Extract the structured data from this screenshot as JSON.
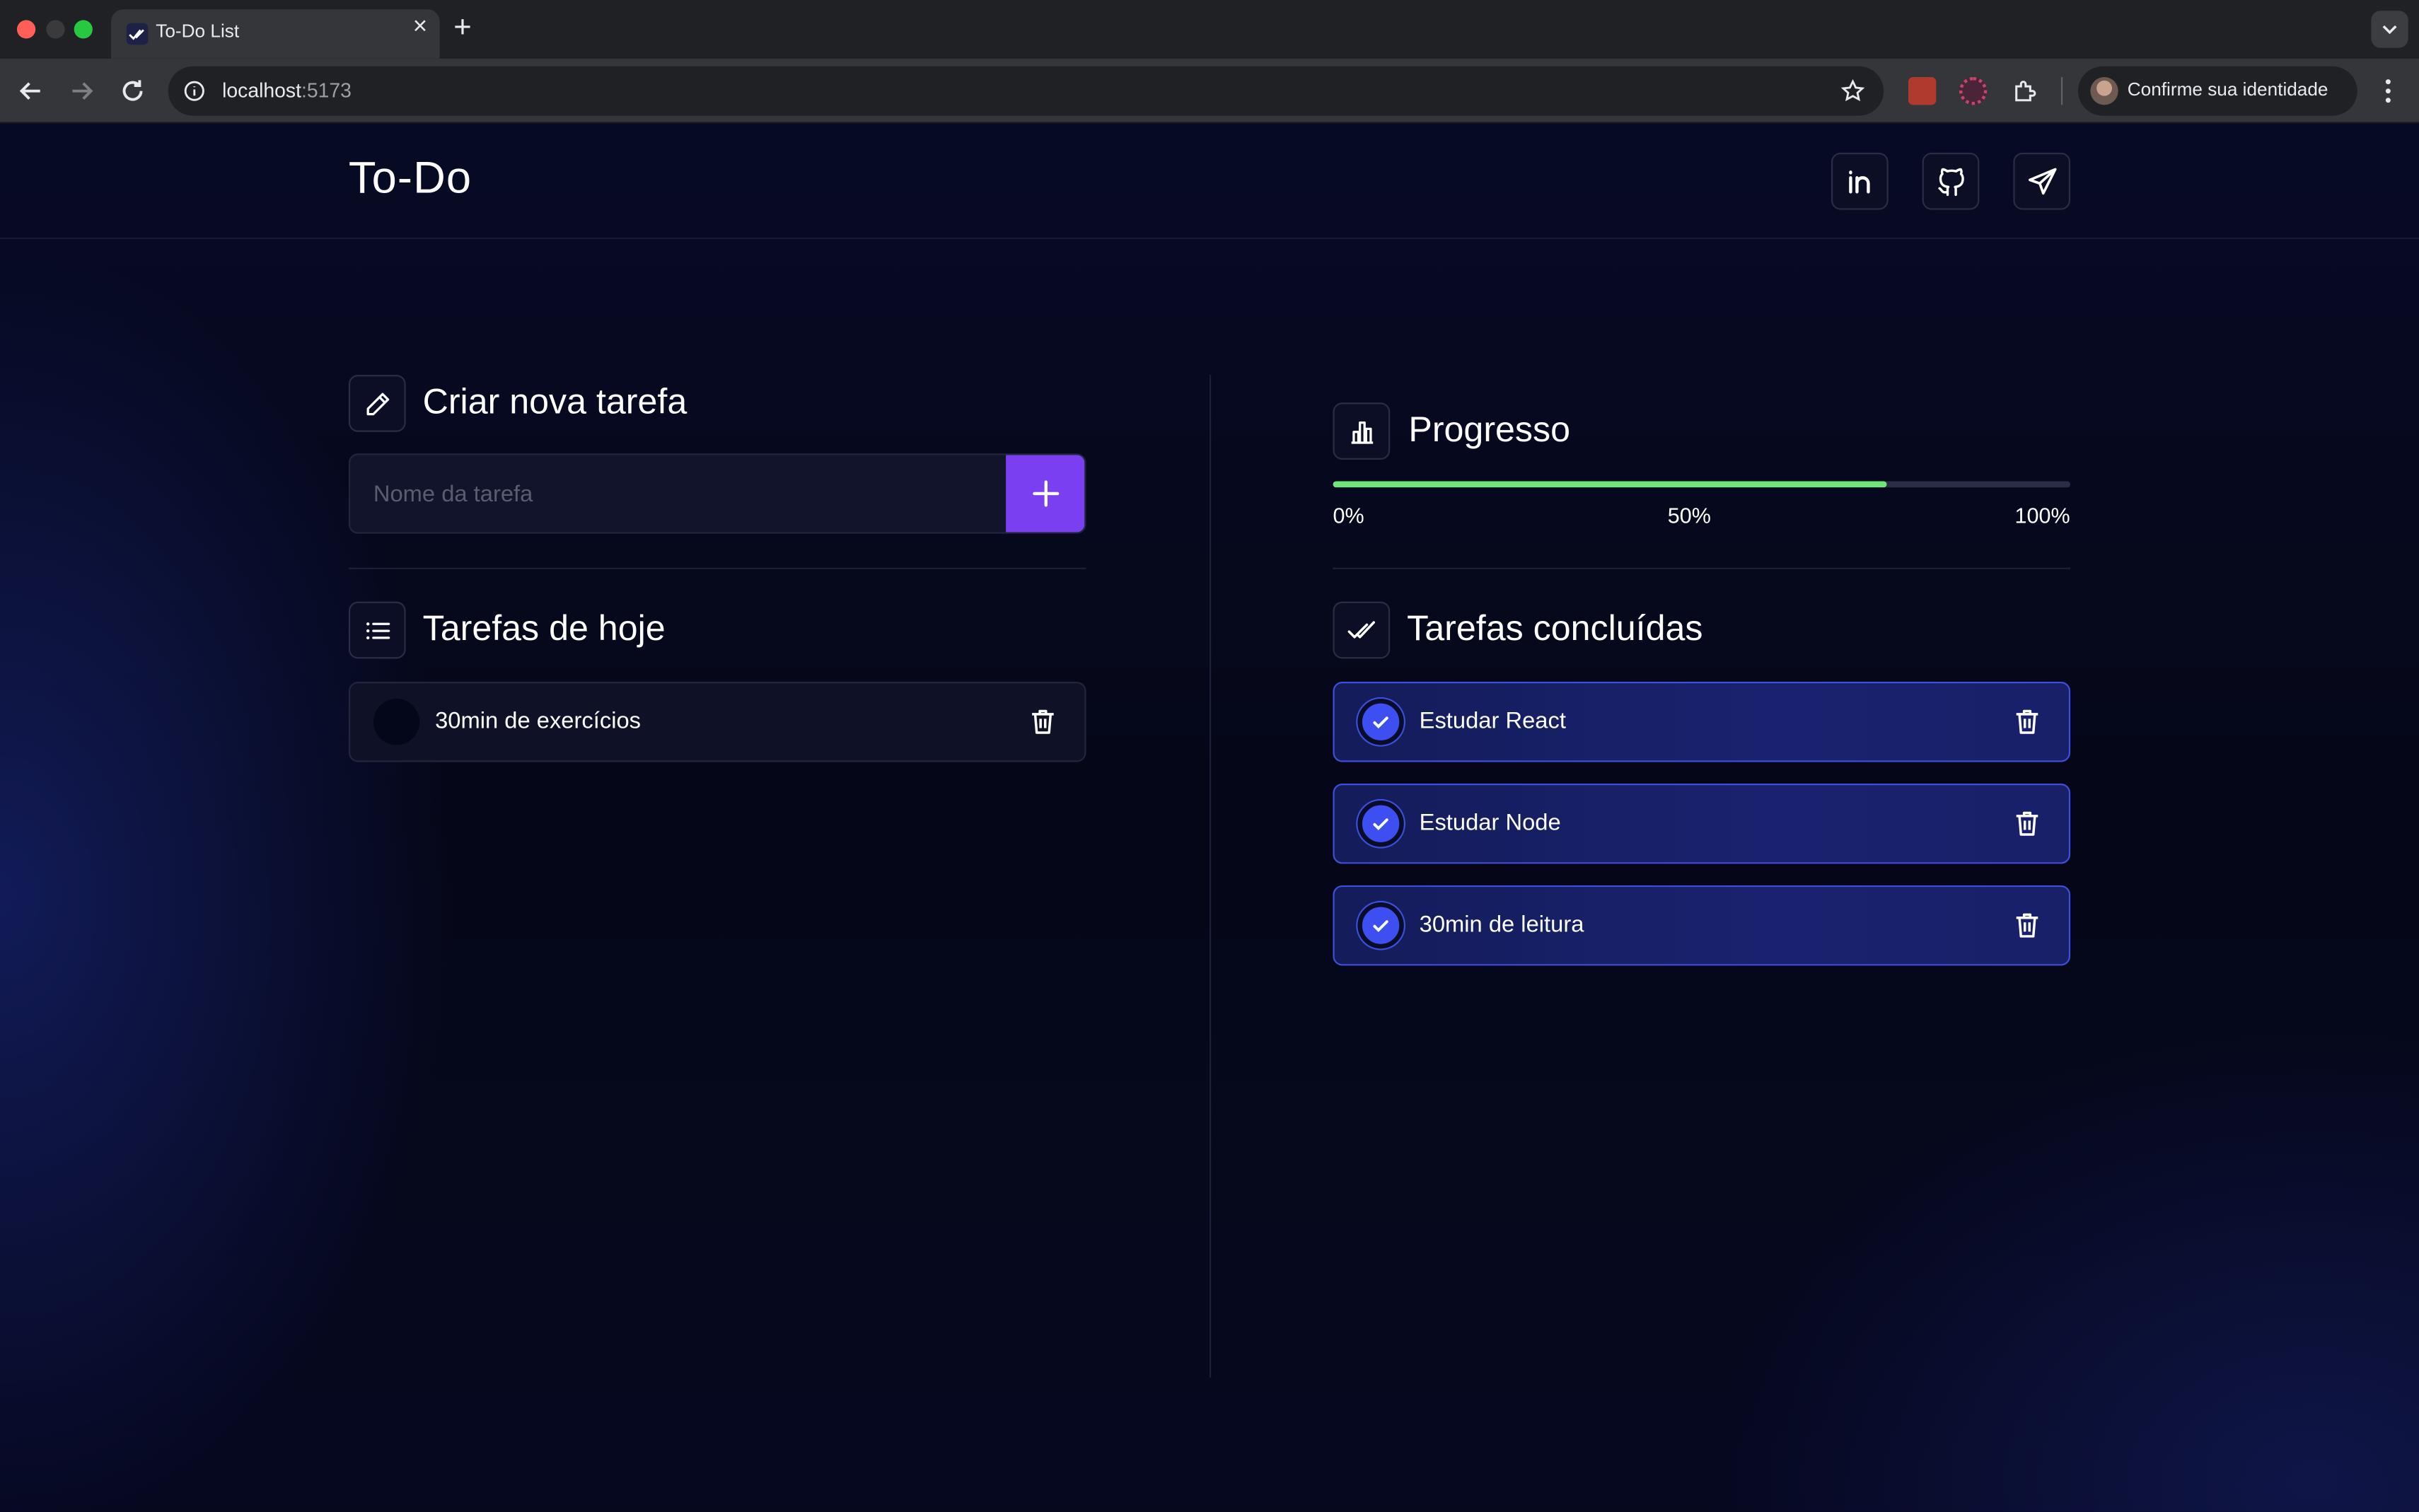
{
  "browser": {
    "tab_title": "To-Do List",
    "url_host": "localhost",
    "url_port": ":5173",
    "profile_label": "Confirme sua identidade"
  },
  "header": {
    "brand": "To-Do",
    "social": [
      {
        "name": "linkedin-icon"
      },
      {
        "name": "github-icon"
      },
      {
        "name": "telegram-icon"
      }
    ]
  },
  "create": {
    "title": "Criar nova tarefa",
    "placeholder": "Nome da tarefa",
    "value": ""
  },
  "today": {
    "title": "Tarefas de hoje",
    "tasks": [
      {
        "label": "30min de exercícios",
        "done": false
      }
    ]
  },
  "progress": {
    "title": "Progresso",
    "fraction": 0.75,
    "labels": [
      "0%",
      "50%",
      "100%"
    ]
  },
  "completed": {
    "title": "Tarefas concluídas",
    "tasks": [
      {
        "label": "Estudar React",
        "done": true
      },
      {
        "label": "Estudar Node",
        "done": true
      },
      {
        "label": "30min de leitura",
        "done": true
      }
    ]
  },
  "colors": {
    "accent": "#7b3ff2",
    "progress": "#6ee67a",
    "done_border": "#3d4fe0",
    "background": "#06081c"
  }
}
